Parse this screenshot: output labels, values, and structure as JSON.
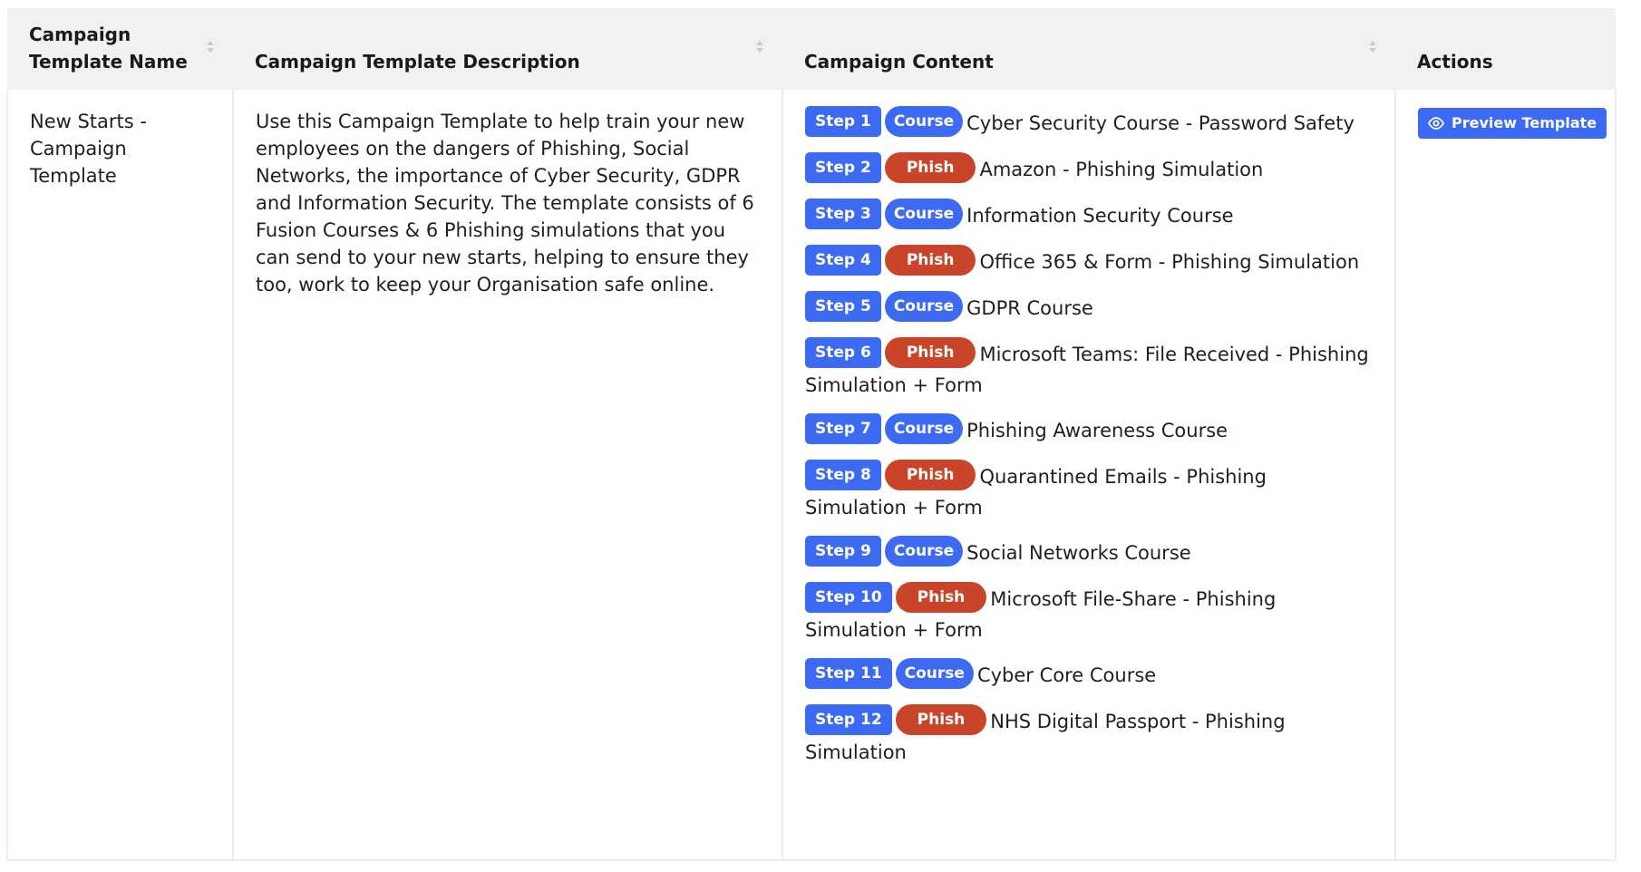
{
  "table": {
    "headers": {
      "name": "Campaign Template Name",
      "description": "Campaign Template Description",
      "content": "Campaign Content",
      "actions": "Actions"
    },
    "row": {
      "name": "New Starts - Campaign Template",
      "description": "Use this Campaign Template to help train your new employees on the dangers of Phishing, Social Networks, the importance of Cyber Security, GDPR and Information Security. The template consists of 6 Fusion Courses & 6 Phishing simulations that you can send to your new starts, helping to ensure they too, work to keep your Organisation safe online.",
      "steps": [
        {
          "step": "Step 1",
          "type": "Course",
          "title": "Cyber Security Course - Password Safety"
        },
        {
          "step": "Step 2",
          "type": "Phish",
          "title": "Amazon - Phishing Simulation"
        },
        {
          "step": "Step 3",
          "type": "Course",
          "title": "Information Security Course"
        },
        {
          "step": "Step 4",
          "type": "Phish",
          "title": "Office 365 & Form - Phishing Simulation"
        },
        {
          "step": "Step 5",
          "type": "Course",
          "title": "GDPR Course"
        },
        {
          "step": "Step 6",
          "type": "Phish",
          "title": "Microsoft Teams: File Received - Phishing Simulation + Form"
        },
        {
          "step": "Step 7",
          "type": "Course",
          "title": "Phishing Awareness Course"
        },
        {
          "step": "Step 8",
          "type": "Phish",
          "title": "Quarantined Emails - Phishing Simulation + Form"
        },
        {
          "step": "Step 9",
          "type": "Course",
          "title": "Social Networks Course"
        },
        {
          "step": "Step 10",
          "type": "Phish",
          "title": "Microsoft File-Share - Phishing Simulation + Form"
        },
        {
          "step": "Step 11",
          "type": "Course",
          "title": "Cyber Core Course"
        },
        {
          "step": "Step 12",
          "type": "Phish",
          "title": "NHS Digital Passport - Phishing Simulation"
        }
      ],
      "action_label": "Preview Template",
      "action_icon": "eye-icon"
    }
  },
  "colors": {
    "step_badge": "#3d6af2",
    "course_badge": "#3d6af2",
    "phish_badge": "#c94428",
    "header_bg": "#f1f1f3"
  }
}
